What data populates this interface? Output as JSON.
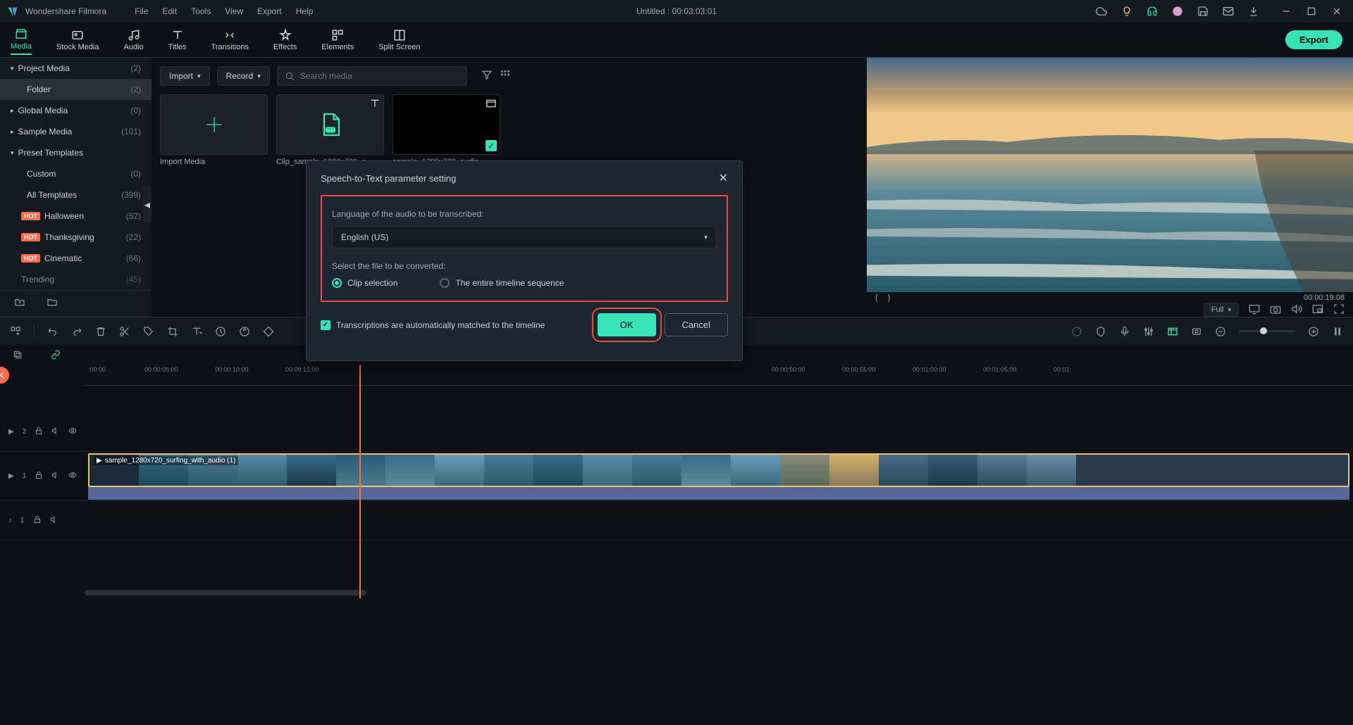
{
  "title_bar": {
    "app_name": "Wondershare Filmora",
    "menus": [
      "File",
      "Edit",
      "Tools",
      "View",
      "Export",
      "Help"
    ],
    "doc_title": "Untitled : 00:03:03:01"
  },
  "tabs": {
    "items": [
      "Media",
      "Stock Media",
      "Audio",
      "Titles",
      "Transitions",
      "Effects",
      "Elements",
      "Split Screen"
    ],
    "active": "Media",
    "export": "Export"
  },
  "sidebar": {
    "items": [
      {
        "label": "Project Media",
        "count": "(2)",
        "caret": "▾",
        "selected": false
      },
      {
        "label": "Folder",
        "count": "(2)",
        "indent": true,
        "selected": true
      },
      {
        "label": "Global Media",
        "count": "(0)",
        "caret": "▸"
      },
      {
        "label": "Sample Media",
        "count": "(101)",
        "caret": "▸"
      },
      {
        "label": "Preset Templates",
        "count": "",
        "caret": "▾"
      },
      {
        "label": "Custom",
        "count": "(0)",
        "indent": true
      },
      {
        "label": "All Templates",
        "count": "(399)",
        "indent": true
      },
      {
        "label": "Halloween",
        "count": "(52)",
        "hot": true,
        "indent2": true
      },
      {
        "label": "Thanksgiving",
        "count": "(22)",
        "hot": true,
        "indent2": true
      },
      {
        "label": "Cinematic",
        "count": "(66)",
        "hot": true,
        "indent2": true
      },
      {
        "label": "Trending",
        "count": "(45)",
        "indent2": true
      }
    ]
  },
  "media_toolbar": {
    "import": "Import",
    "record": "Record",
    "search_placeholder": "Search media"
  },
  "media_items": [
    {
      "caption": "Import Media",
      "type": "import"
    },
    {
      "caption": "Clip_sample_1280x720_s...",
      "type": "subtitle"
    },
    {
      "caption": "sample_1280x720_surfin...",
      "type": "video"
    }
  ],
  "preview": {
    "timecode": "00:00:19:08",
    "zoom": "Full"
  },
  "ruler_marks": [
    ":00:00",
    "00:00:05:00",
    "00:00:10:00",
    "00:00:15:00",
    "00:00:50:00",
    "00:00:55:00",
    "00:01:00:00",
    "00:01:05:00",
    "00:01:"
  ],
  "tracks": {
    "v2_label": "2",
    "v1_label": "1",
    "a1_label": "1",
    "clip_name": "sample_1280x720_surfing_with_audio (1)"
  },
  "dialog": {
    "title": "Speech-to-Text parameter setting",
    "lang_label": "Language of the audio to be transcribed:",
    "lang_value": "English (US)",
    "file_label": "Select the file to be converted:",
    "radio1": "Clip selection",
    "radio2": "The entire timeline sequence",
    "check_label": "Transcriptions are automatically matched to the timeline",
    "ok": "OK",
    "cancel": "Cancel"
  }
}
